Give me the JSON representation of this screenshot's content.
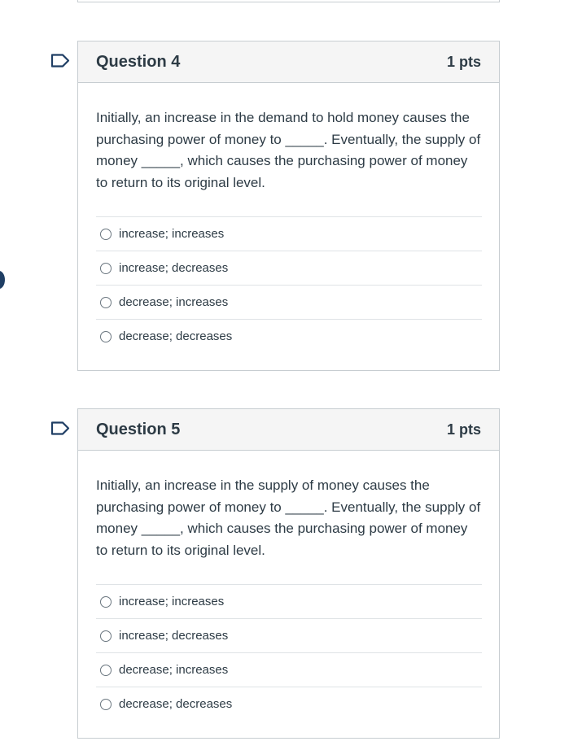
{
  "questions": [
    {
      "title": "Question 4",
      "points": "1 pts",
      "text": "Initially, an increase in the demand to hold money causes the purchasing power of money to _____. Eventually, the supply of money _____, which causes the purchasing power of money to return to its original level.",
      "options": [
        "increase; increases",
        "increase; decreases",
        "decrease; increases",
        "decrease; decreases"
      ]
    },
    {
      "title": "Question 5",
      "points": "1 pts",
      "text": "Initially, an increase in the supply of money causes the purchasing power of money to _____. Eventually, the supply of money _____, which causes the purchasing power of money to return to its original level.",
      "options": [
        "increase; increases",
        "increase; decreases",
        "decrease; increases",
        "decrease; decreases"
      ]
    }
  ],
  "colors": {
    "flag": "#1f3e64",
    "border": "#c7cdd1",
    "header_bg": "#f5f5f5",
    "text": "#2d3b45"
  }
}
